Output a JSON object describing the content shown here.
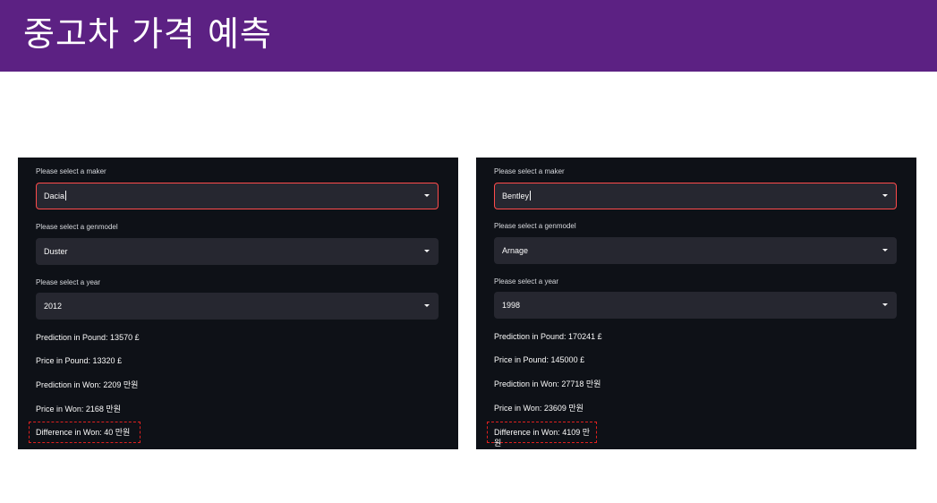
{
  "header": {
    "title": "중고차 가격 예측",
    "background": "#5c2183"
  },
  "panels": [
    {
      "maker_label": "Please select a maker",
      "maker_value": "Dacia",
      "genmodel_label": "Please select a genmodel",
      "genmodel_value": "Duster",
      "year_label": "Please select a year",
      "year_value": "2012",
      "prediction_pound": "Prediction in Pound: 13570 £",
      "price_pound": "Price in Pound: 13320 £",
      "prediction_won": "Prediction in Won: 2209 만원",
      "price_won": "Price in Won: 2168 만원",
      "difference_won": "Difference in Won: 40 만원"
    },
    {
      "maker_label": "Please select a maker",
      "maker_value": "Bentley",
      "genmodel_label": "Please select a genmodel",
      "genmodel_value": "Arnage",
      "year_label": "Please select a year",
      "year_value": "1998",
      "prediction_pound": "Prediction in Pound: 170241 £",
      "price_pound": "Price in Pound: 145000 £",
      "prediction_won": "Prediction in Won: 27718 만원",
      "price_won": "Price in Won: 23609 만원",
      "difference_won": "Difference in Won: 4109 만원"
    }
  ],
  "colors": {
    "panel_bg": "#0e1117",
    "select_bg": "#262730",
    "focus_border": "#ff4b4b",
    "highlight_border": "#e0201f"
  },
  "icons": {
    "dropdown": "chevron-down-icon"
  }
}
